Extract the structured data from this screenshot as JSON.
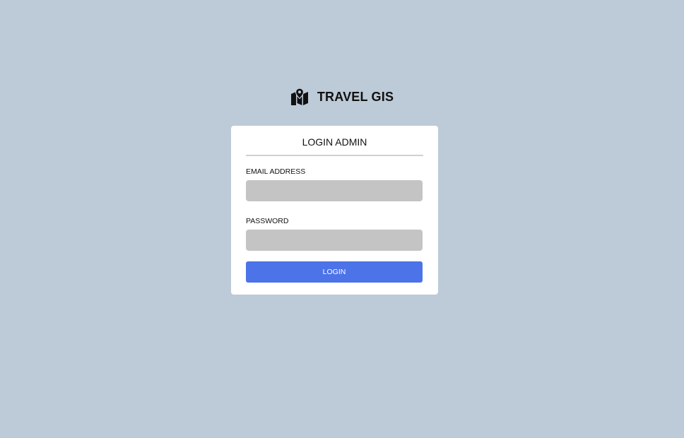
{
  "brand": {
    "icon": "map-marker-icon",
    "title": "TRAVEL GIS"
  },
  "login_card": {
    "title": "LOGIN ADMIN",
    "email": {
      "label": "EMAIL ADDRESS",
      "value": "",
      "placeholder": ""
    },
    "password": {
      "label": "PASSWORD",
      "value": "",
      "placeholder": ""
    },
    "submit_label": "LOGIN"
  },
  "colors": {
    "background": "#bdcad7",
    "card": "#ffffff",
    "input": "#c4c4c4",
    "button": "#4d73e8"
  }
}
